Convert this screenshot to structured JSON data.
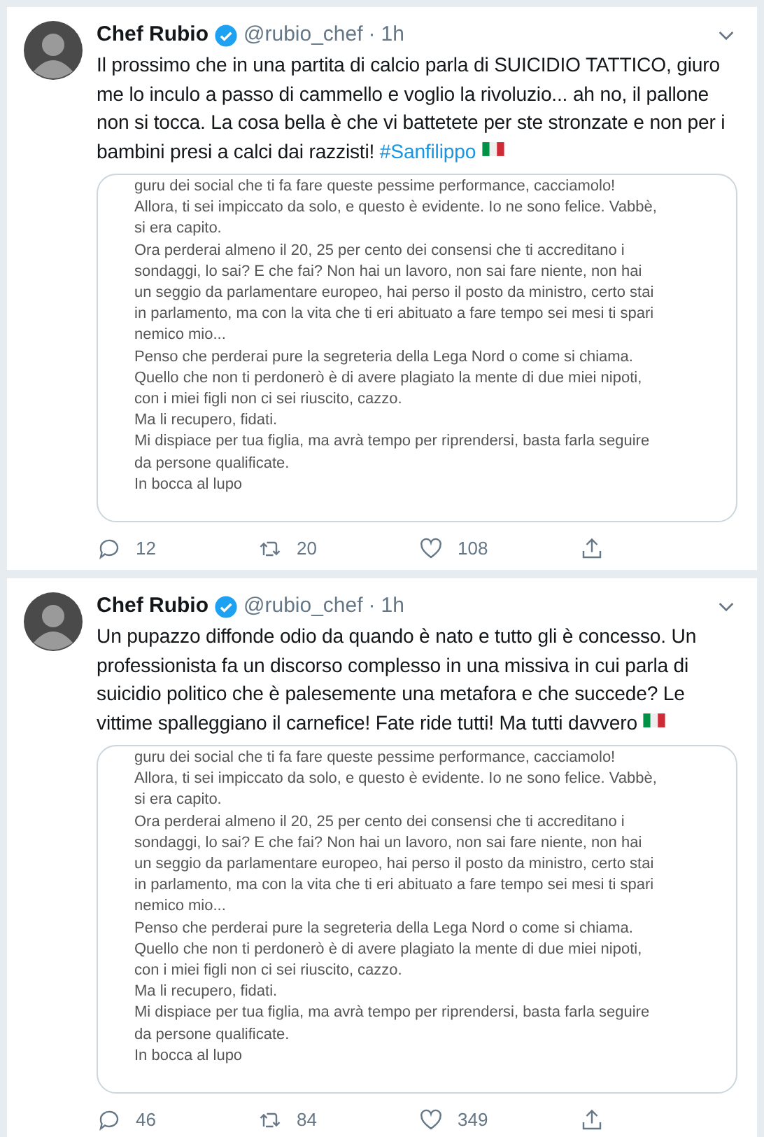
{
  "tweets": [
    {
      "author": "Chef Rubio",
      "verified": true,
      "handle": "@rubio_chef",
      "dot": "·",
      "time": "1h",
      "text": "Il prossimo che in una partita di calcio parla di SUICIDIO TATTICO, giuro me lo inculo a passo di cammello e voglio la rivoluzio... ah no, il pallone non si tocca. La cosa bella è che vi battetete per ste stronzate e non per i bambini presi a calci dai razzisti!",
      "hashtag": "#Sanfilippo",
      "image_lines": [
        "guru dei social che ti fa fare queste pessime performance, cacciamolo!",
        "Allora, ti sei impiccato da solo, e questo è evidente. Io ne sono felice. Vabbè,",
        "si era capito.",
        "Ora perderai almeno il 20, 25 per cento dei consensi che ti accreditano i",
        "sondaggi, lo sai? E che fai? Non hai un lavoro, non sai fare niente, non hai",
        "un seggio da parlamentare europeo, hai perso il posto da ministro, certo stai",
        "in parlamento, ma con la vita che ti eri abituato a fare tempo sei mesi ti spari",
        "nemico mio...",
        "Penso che perderai pure la segreteria della Lega Nord o come si chiama.",
        "Quello che non ti perdonerò è di avere plagiato la mente di due miei nipoti,",
        "con i miei figli non ci sei riuscito, cazzo.",
        "Ma li recupero, fidati.",
        "Mi dispiace per tua figlia, ma avrà tempo per riprendersi, basta farla seguire",
        "da persone qualificate.",
        "In bocca al lupo"
      ],
      "replies": "12",
      "retweets": "20",
      "likes": "108"
    },
    {
      "author": "Chef Rubio",
      "verified": true,
      "handle": "@rubio_chef",
      "dot": "·",
      "time": "1h",
      "text": "Un pupazzo diffonde odio da quando è nato e tutto gli è concesso. Un professionista fa un discorso complesso in una missiva in cui parla di suicidio politico che è palesemente una metafora e che succede? Le vittime spalleggiano il carnefice! Fate ride tutti! Ma tutti davvero",
      "image_lines": [
        "guru dei social che ti fa fare queste pessime performance, cacciamolo!",
        "Allora, ti sei impiccato da solo, e questo è evidente. Io ne sono felice. Vabbè,",
        "si era capito.",
        "Ora perderai almeno il 20, 25 per cento dei consensi che ti accreditano i",
        "sondaggi, lo sai? E che fai? Non hai un lavoro, non sai fare niente, non hai",
        "un seggio da parlamentare europeo, hai perso il posto da ministro, certo stai",
        "in parlamento, ma con la vita che ti eri abituato a fare tempo sei mesi ti spari",
        "nemico mio...",
        "Penso che perderai pure la segreteria della Lega Nord o come si chiama.",
        "Quello che non ti perdonerò è di avere plagiato la mente di due miei nipoti,",
        "con i miei figli non ci sei riuscito, cazzo.",
        "Ma li recupero, fidati.",
        "Mi dispiace per tua figlia, ma avrà tempo per riprendersi, basta farla seguire",
        "da persone qualificate.",
        "In bocca al lupo"
      ],
      "replies": "46",
      "retweets": "84",
      "likes": "349"
    }
  ]
}
